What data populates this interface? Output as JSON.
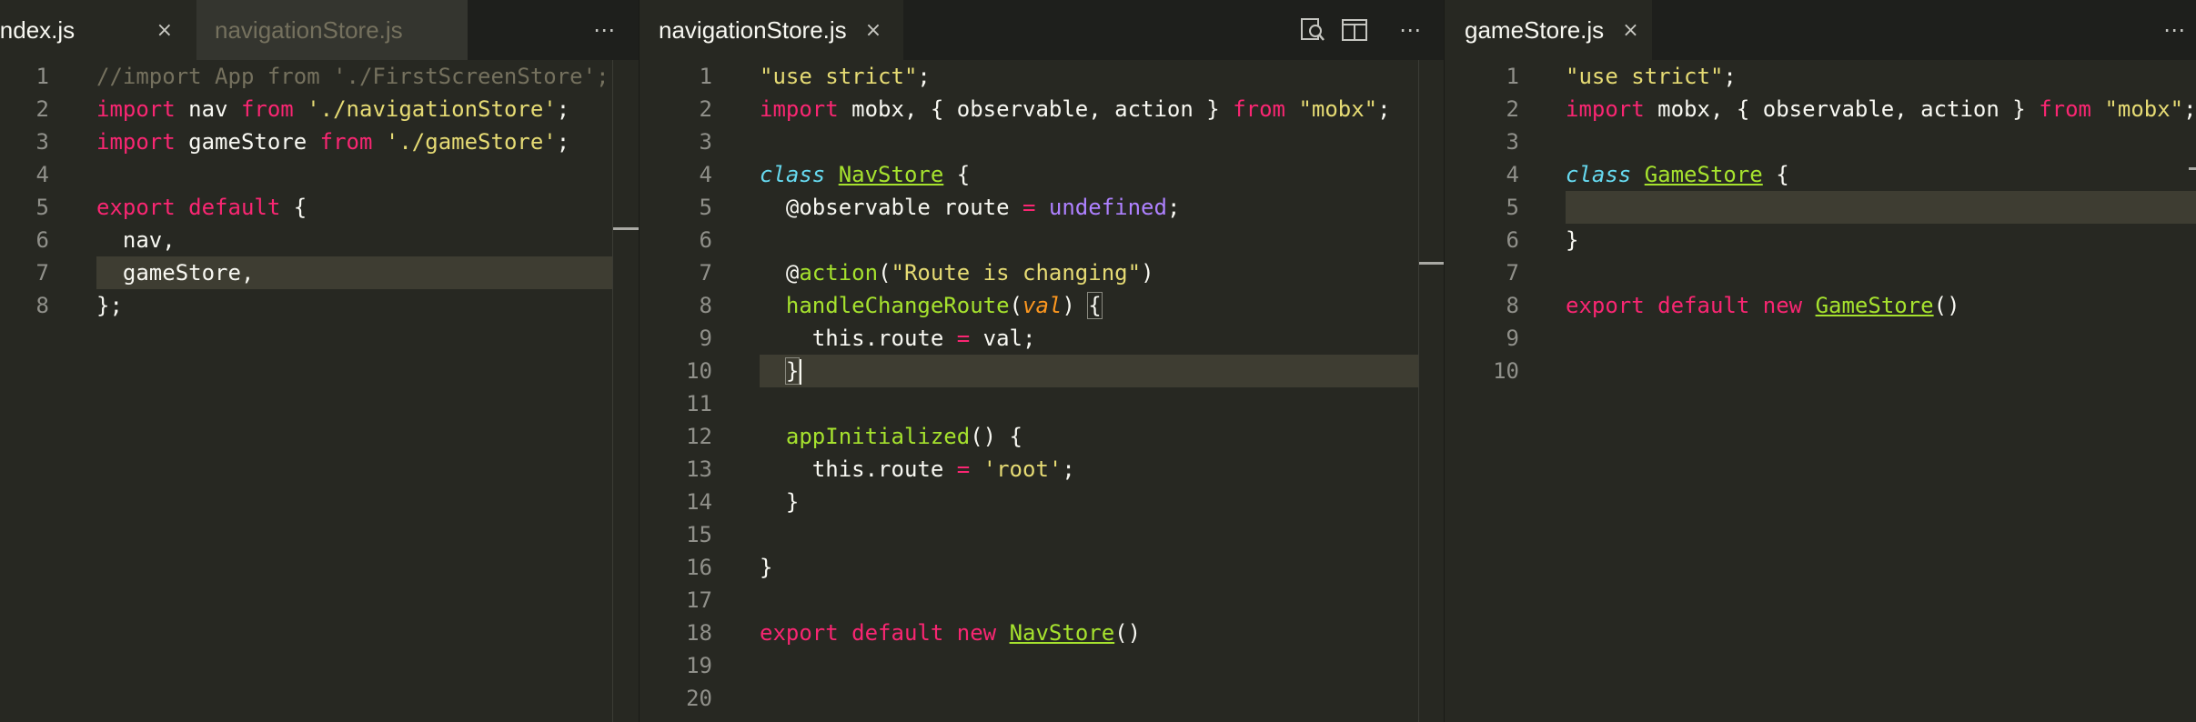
{
  "editor": {
    "groups": [
      {
        "tabs": [
          {
            "label": "index.js",
            "active": true,
            "close": "×"
          },
          {
            "label": "navigationStore.js",
            "active": false
          }
        ],
        "more": "⋯",
        "lines": [
          {
            "num": "1",
            "text": "//import App from './FirstScreenStore';"
          },
          {
            "num": "2",
            "text": "import nav from './navigationStore';"
          },
          {
            "num": "3",
            "text": "import gameStore from './gameStore';"
          },
          {
            "num": "4",
            "text": ""
          },
          {
            "num": "5",
            "text": "export default {"
          },
          {
            "num": "6",
            "text": "  nav,"
          },
          {
            "num": "7",
            "text": "  gameStore,"
          },
          {
            "num": "8",
            "text": "};"
          }
        ]
      },
      {
        "tabs": [
          {
            "label": "navigationStore.js",
            "active": true,
            "close": "×"
          }
        ],
        "actions": {
          "search": "search-preview-icon",
          "split": "split-editor-icon",
          "more": "⋯"
        },
        "lines": [
          {
            "num": "1",
            "text": "\"use strict\";"
          },
          {
            "num": "2",
            "text": "import mobx, { observable, action } from \"mobx\";"
          },
          {
            "num": "3",
            "text": ""
          },
          {
            "num": "4",
            "text": "class NavStore {"
          },
          {
            "num": "5",
            "text": "  @observable route = undefined;"
          },
          {
            "num": "6",
            "text": ""
          },
          {
            "num": "7",
            "text": "  @action(\"Route is changing\")"
          },
          {
            "num": "8",
            "text": "  handleChangeRoute(val) {"
          },
          {
            "num": "9",
            "text": "    this.route = val;"
          },
          {
            "num": "10",
            "text": "  }"
          },
          {
            "num": "11",
            "text": ""
          },
          {
            "num": "12",
            "text": "  appInitialized() {"
          },
          {
            "num": "13",
            "text": "    this.route = 'root';"
          },
          {
            "num": "14",
            "text": "  }"
          },
          {
            "num": "15",
            "text": ""
          },
          {
            "num": "16",
            "text": "}"
          },
          {
            "num": "17",
            "text": ""
          },
          {
            "num": "18",
            "text": "export default new NavStore()"
          },
          {
            "num": "19",
            "text": ""
          },
          {
            "num": "20",
            "text": ""
          }
        ]
      },
      {
        "tabs": [
          {
            "label": "gameStore.js",
            "active": true,
            "close": "×"
          }
        ],
        "more": "⋯",
        "lines": [
          {
            "num": "1",
            "text": "\"use strict\";"
          },
          {
            "num": "2",
            "text": "import mobx, { observable, action } from \"mobx\";"
          },
          {
            "num": "3",
            "text": ""
          },
          {
            "num": "4",
            "text": "class GameStore {"
          },
          {
            "num": "5",
            "text": ""
          },
          {
            "num": "6",
            "text": "}"
          },
          {
            "num": "7",
            "text": ""
          },
          {
            "num": "8",
            "text": "export default new GameStore()"
          },
          {
            "num": "9",
            "text": ""
          },
          {
            "num": "10",
            "text": ""
          }
        ]
      }
    ]
  },
  "theme": {
    "background": "#272822",
    "keyword": "#f92672",
    "string": "#e6db74",
    "comment": "#75715e",
    "function": "#a6e22e",
    "storage": "#66d9ef",
    "parameter": "#fd971f",
    "constant": "#ae81ff",
    "line_highlight": "#3e3d32"
  }
}
